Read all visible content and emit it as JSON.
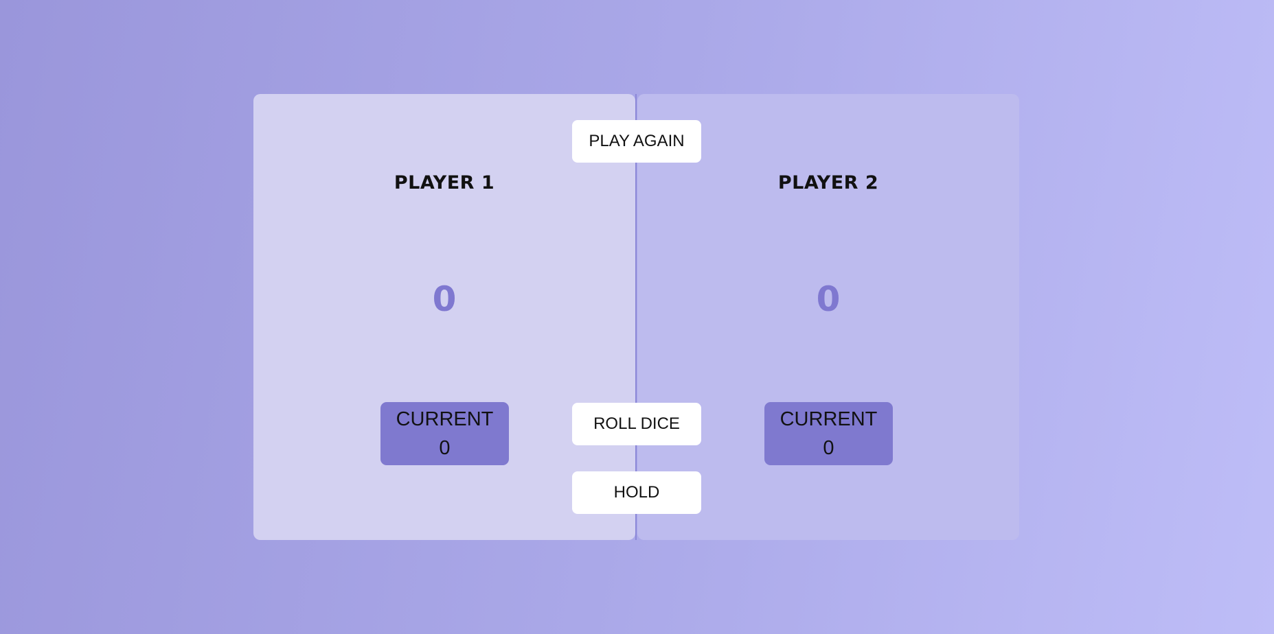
{
  "players": [
    {
      "name": "PLAYER 1",
      "score": "0",
      "current_label": "CURRENT",
      "current_score": "0",
      "active": true
    },
    {
      "name": "PLAYER 2",
      "score": "0",
      "current_label": "CURRENT",
      "current_score": "0",
      "active": false
    }
  ],
  "buttons": {
    "new_game": "PLAY AGAIN",
    "roll": "ROLL DICE",
    "hold": "HOLD"
  },
  "colors": {
    "accent": "#7f79cf",
    "score_text": "#7f78d0",
    "active_panel": "#d3d1f1",
    "inactive_panel": "#bdbbee"
  }
}
